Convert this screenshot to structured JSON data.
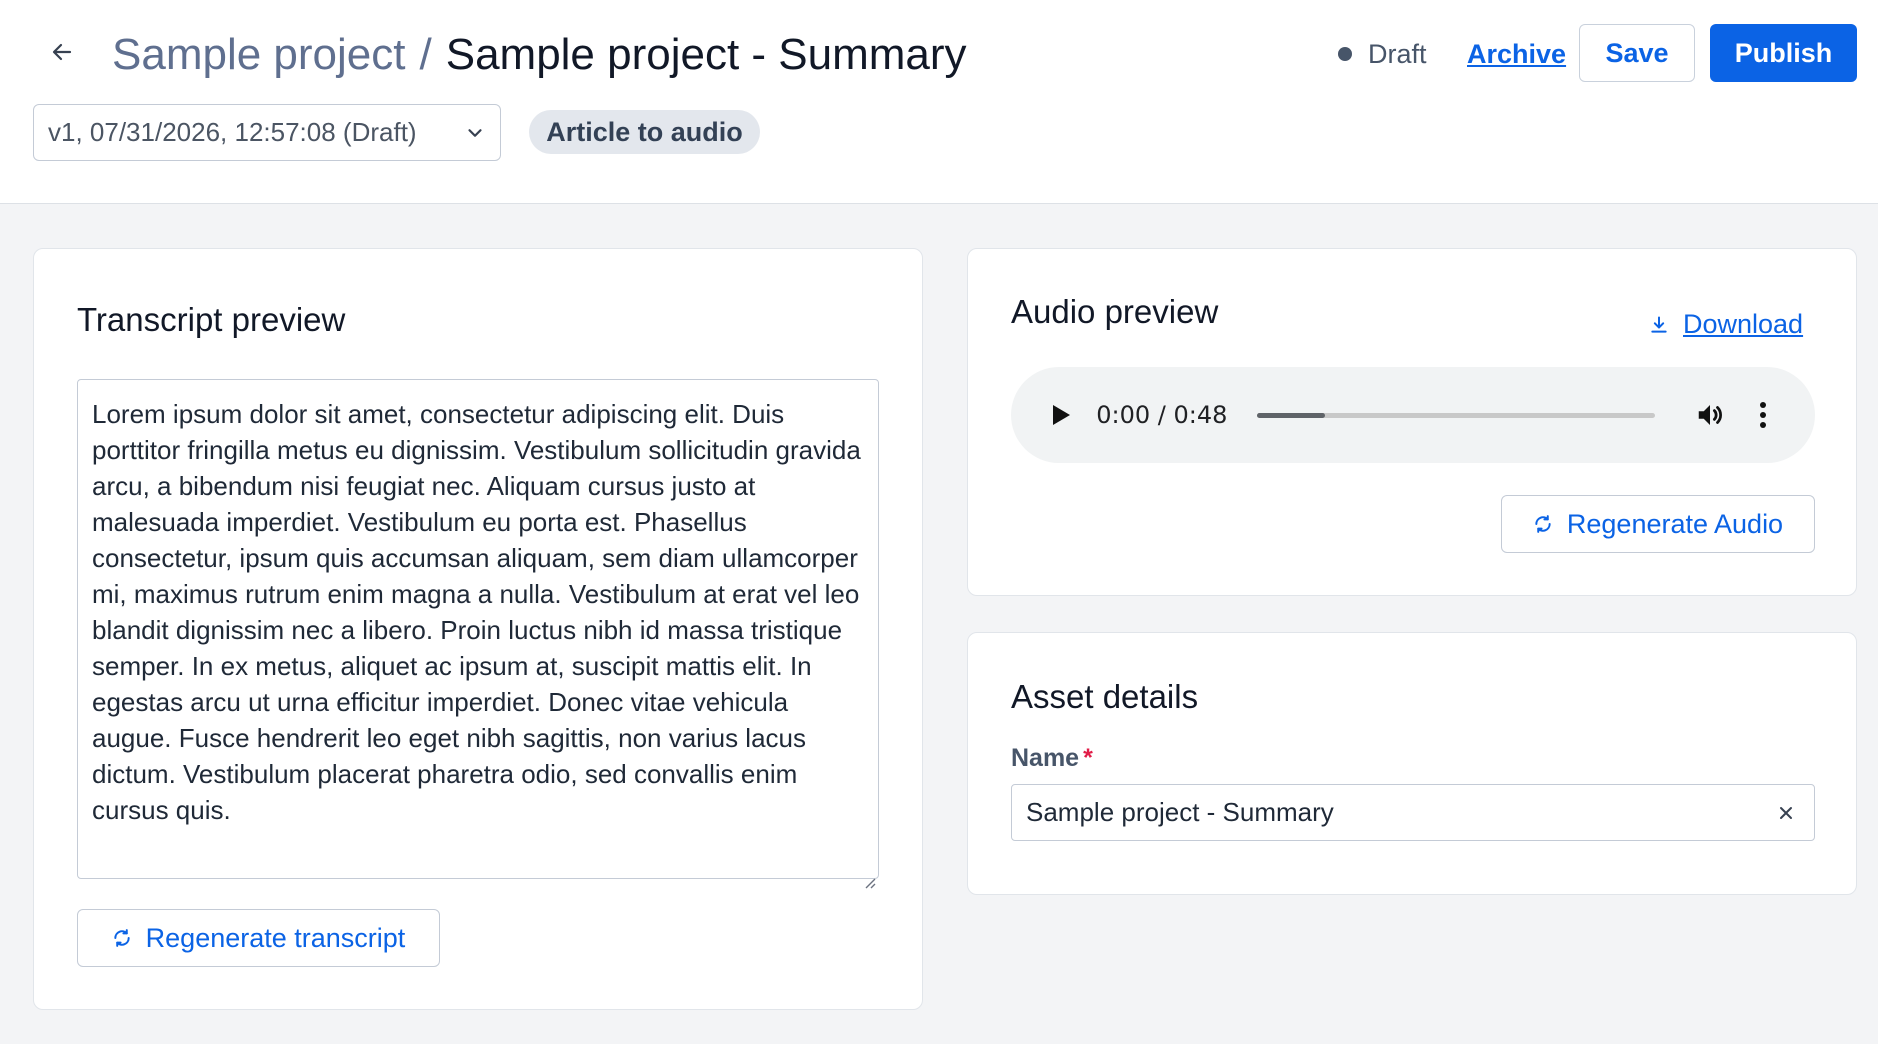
{
  "header": {
    "breadcrumb_parent": "Sample project",
    "breadcrumb_separator": "/",
    "title": "Sample project - Summary",
    "status_label": "Draft",
    "archive_label": "Archive",
    "save_label": "Save",
    "publish_label": "Publish",
    "version_value": "v1, 07/31/2026, 12:57:08 (Draft)",
    "type_pill": "Article to audio"
  },
  "transcript": {
    "title": "Transcript preview",
    "text": "Lorem ipsum dolor sit amet, consectetur adipiscing elit. Duis porttitor fringilla metus eu dignissim. Vestibulum sollicitudin gravida arcu, a bibendum nisi feugiat nec. Aliquam cursus justo at malesuada imperdiet. Vestibulum eu porta est. Phasellus consectetur, ipsum quis accumsan aliquam, sem diam ullamcorper mi, maximus rutrum enim magna a nulla. Vestibulum at erat vel leo blandit dignissim nec a libero. Proin luctus nibh id massa tristique semper. In ex metus, aliquet ac ipsum at, suscipit mattis elit. In egestas arcu ut urna efficitur imperdiet. Donec vitae vehicula augue. Fusce hendrerit leo eget nibh sagittis, non varius lacus dictum. Vestibulum placerat pharetra odio, sed convallis enim cursus quis.",
    "regenerate_label": "Regenerate transcript"
  },
  "audio": {
    "title": "Audio preview",
    "download_label": "Download",
    "time_display": "0:00 / 0:48",
    "progress_fraction": 0.17,
    "regenerate_label": "Regenerate Audio"
  },
  "asset": {
    "title": "Asset details",
    "name_label": "Name",
    "required_marker": "*",
    "name_value": "Sample project - Summary"
  },
  "colors": {
    "accent": "#0b63e5",
    "page_background": "#f3f4f6",
    "required": "#e11d48"
  },
  "icons": {
    "back": "arrow-left-icon",
    "dropdown": "chevron-down-icon",
    "regenerate": "refresh-icon",
    "download": "download-icon",
    "play": "play-icon",
    "volume": "volume-icon",
    "more": "more-vertical-icon",
    "clear": "close-icon"
  }
}
